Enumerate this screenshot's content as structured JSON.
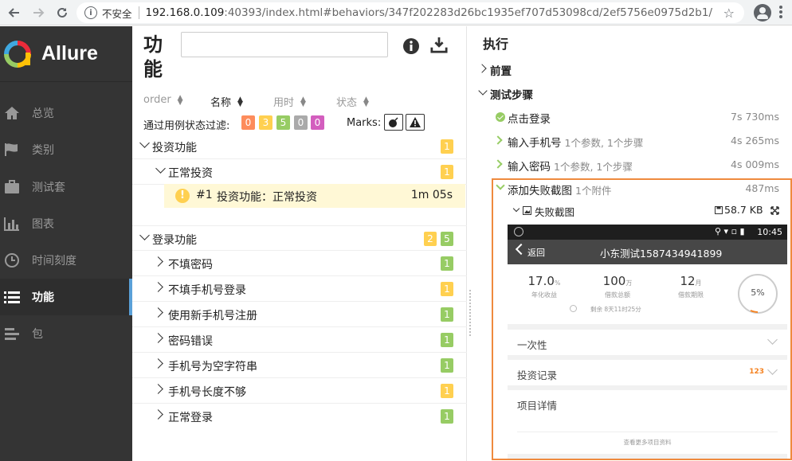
{
  "browser": {
    "insecure_label": "不安全",
    "url_host": "192.168.0.109",
    "url_rest": ":40393/index.html#behaviors/347f202283d26bc1935ef707d53098cd/2ef5756e0975d2b1/"
  },
  "sidebar": {
    "brand": "Allure",
    "items": [
      {
        "label": "总览",
        "icon": "home-icon"
      },
      {
        "label": "类别",
        "icon": "flag-icon"
      },
      {
        "label": "测试套",
        "icon": "briefcase-icon"
      },
      {
        "label": "图表",
        "icon": "bar-chart-icon"
      },
      {
        "label": "时间刻度",
        "icon": "clock-icon"
      },
      {
        "label": "功能",
        "icon": "list-icon",
        "active": true
      },
      {
        "label": "包",
        "icon": "package-icon"
      }
    ]
  },
  "middle": {
    "title": "功能",
    "sort": {
      "order": "order",
      "name": "名称",
      "duration": "用时",
      "status": "状态"
    },
    "filter_label": "通过用例状态过滤:",
    "filter_counts": [
      "0",
      "3",
      "5",
      "0",
      "0"
    ],
    "marks_label": "Marks:",
    "groups": [
      {
        "label": "投资功能",
        "counts": [
          {
            "value": "1",
            "color": "yellow"
          }
        ],
        "children": [
          {
            "label": "正常投资",
            "counts": [
              {
                "value": "1",
                "color": "yellow"
              }
            ],
            "leaf": {
              "index": "#1",
              "name": "投资功能：正常投资",
              "duration": "1m 05s"
            }
          }
        ]
      },
      {
        "label": "登录功能",
        "counts": [
          {
            "value": "2",
            "color": "yellow"
          },
          {
            "value": "5",
            "color": "green"
          }
        ],
        "children": [
          {
            "label": "不填密码",
            "count": "1",
            "color": "green"
          },
          {
            "label": "不填手机号登录",
            "count": "1",
            "color": "yellow"
          },
          {
            "label": "使用新手机号注册",
            "count": "1",
            "color": "green"
          },
          {
            "label": "密码错误",
            "count": "1",
            "color": "green"
          },
          {
            "label": "手机号为空字符串",
            "count": "1",
            "color": "green"
          },
          {
            "label": "手机号长度不够",
            "count": "1",
            "color": "yellow"
          },
          {
            "label": "正常登录",
            "count": "1",
            "color": "green"
          }
        ]
      }
    ]
  },
  "right": {
    "title": "执行",
    "setup": "前置",
    "steps_label": "测试步骤",
    "steps": [
      {
        "name": "点击登录",
        "meta": "",
        "time": "7s 730ms"
      },
      {
        "name": "输入手机号",
        "meta": "1个参数, 1个步骤",
        "time": "4s 265ms"
      },
      {
        "name": "输入密码",
        "meta": "1个参数, 1个步骤",
        "time": "4s 009ms"
      },
      {
        "name": "添加失败截图",
        "meta": "1个附件",
        "time": "487ms"
      }
    ],
    "attachment": {
      "name": "失败截图",
      "size": "58.7 KB"
    }
  },
  "phone": {
    "time": "10:45",
    "back": "返回",
    "title": "小东测试1587434941899",
    "stats": [
      {
        "value": "17.0",
        "unit": "%",
        "label": "年化收益"
      },
      {
        "value": "100",
        "unit": "万",
        "label": "借款总额"
      },
      {
        "value": "12",
        "unit": "月",
        "label": "借款期限"
      }
    ],
    "progress": "5%",
    "remaining": "剩余 8天11时25分",
    "sections": [
      {
        "label": "一次性",
        "extra": ""
      },
      {
        "label": "投资记录",
        "extra": "123"
      },
      {
        "label": "项目详情",
        "extra": ""
      }
    ],
    "more": "查看更多项目资料"
  }
}
